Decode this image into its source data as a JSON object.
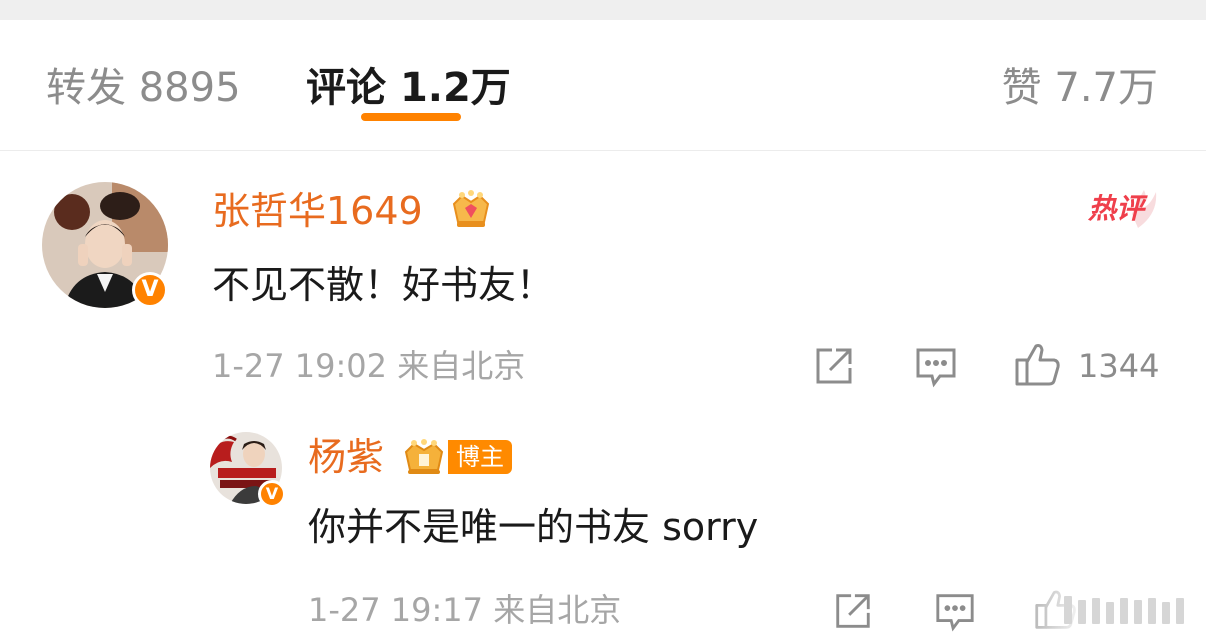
{
  "tabs": {
    "repost": {
      "label": "转发",
      "count": "8895"
    },
    "comments": {
      "label": "评论",
      "count": "1.2万"
    },
    "likes": {
      "label": "赞",
      "count": "7.7万"
    }
  },
  "accent_color": "#ff8200",
  "username_color": "#e86b1f",
  "comments": [
    {
      "username": "张哲华1649",
      "badge_icon": "crown-icon",
      "verified": "V",
      "hot_label": "热评",
      "text": "不见不散！好书友！",
      "time": "1-27 19:02",
      "location": "来自北京",
      "like_count": "1344",
      "actions": [
        "share-icon",
        "reply-icon",
        "like-icon"
      ]
    },
    {
      "username": "杨紫",
      "badge_icon": "crown-icon",
      "role_tag": "博主",
      "verified": "V",
      "text": "你并不是唯一的书友 sorry",
      "time": "1-27 19:17",
      "location": "来自北京",
      "actions": [
        "share-icon",
        "reply-icon",
        "like-icon"
      ]
    }
  ]
}
